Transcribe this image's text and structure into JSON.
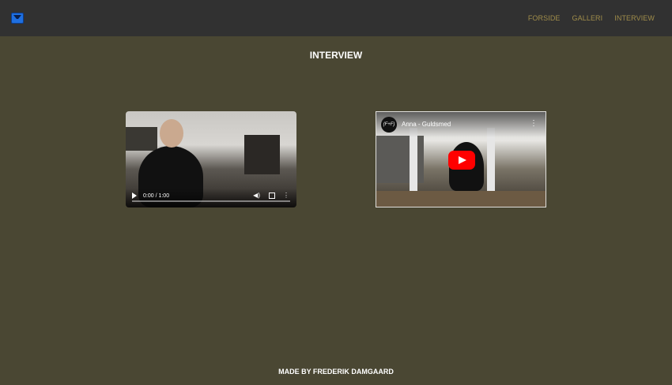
{
  "header": {
    "logo_icon": "logo-icon",
    "nav": [
      {
        "label": "FORSIDE"
      },
      {
        "label": "GALLERI"
      },
      {
        "label": "INTERVIEW"
      }
    ]
  },
  "main": {
    "title": "INTERVIEW",
    "video_1": {
      "time": "0:00 / 1:00",
      "play_icon": "play-icon",
      "volume_icon": "volume-icon",
      "fullscreen_icon": "fullscreen-icon",
      "more_icon": "more-icon"
    },
    "video_2": {
      "channel_avatar": "(F+F)",
      "title": "Anna - Guldsmed",
      "play_icon": "youtube-play-icon",
      "more_icon": "more-icon"
    }
  },
  "footer": {
    "text": "MADE BY FREDERIK DAMGAARD"
  },
  "colors": {
    "background": "#4a4733",
    "header": "#313131",
    "nav_text": "#a08d4a",
    "youtube_red": "#ff0000"
  }
}
